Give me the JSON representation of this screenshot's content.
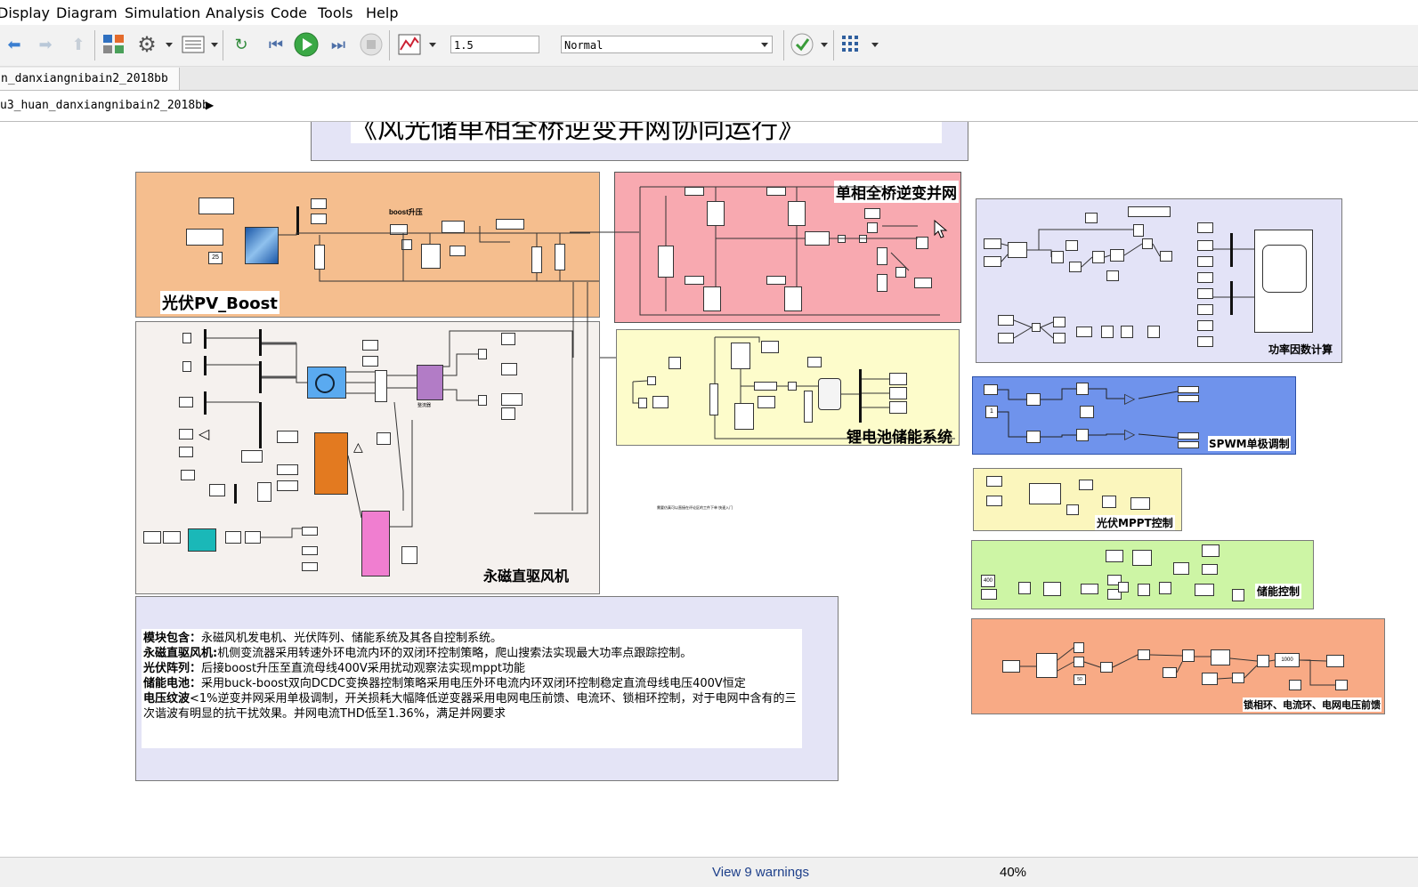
{
  "menu": [
    "Display",
    "Diagram",
    "Simulation",
    "Analysis",
    "Code",
    "Tools",
    "Help"
  ],
  "toolbar": {
    "stop_time": "1.5",
    "sim_mode": "Normal"
  },
  "tab": {
    "label": "n_danxiangnibain2_2018bb"
  },
  "breadcrumb": {
    "path": "u3_huan_danxiangnibain2_2018bb"
  },
  "canvas": {
    "title": "《风光储单相全桥逆变并网协同运行》",
    "areas": {
      "pv_boost": "光伏PV_Boost",
      "boost_label": "boost升压",
      "inverter": "单相全桥逆变并网",
      "pmsg": "永磁直驱风机",
      "battery": "锂电池储能系统",
      "power_factor": "功率因数计算",
      "spwm": "SPWM单极调制",
      "mppt": "光伏MPPT控制",
      "storage_ctrl": "储能控制",
      "pll": "锁相环、电流环、电网电压前馈",
      "irradiance_const": "25",
      "rectifier_label": "整流器",
      "const_1": "1",
      "const_400": "400",
      "const_50": "50",
      "const_1000": "1000",
      "tiny_note": "需要仿真可以直接在评论区的工件下单 快速入门"
    },
    "description": [
      {
        "bold": "模块包含：",
        "text": "永磁风机发电机、光伏阵列、储能系统及其各自控制系统。"
      },
      {
        "bold": "永磁直驱风机:",
        "text": "机侧变流器采用转速外环电流内环的双闭环控制策略，爬山搜索法实现最大功率点跟踪控制。"
      },
      {
        "bold": "光伏阵列：",
        "text": "后接boost升压至直流母线400V采用扰动观察法实现mppt功能"
      },
      {
        "bold": "储能电池：",
        "text": "采用buck-boost双向DCDC变换器控制策略采用电压外环电流内环双闭环控制稳定直流母线电压400V恒定"
      },
      {
        "bold": "电压纹波",
        "text": "<1%逆变并网采用单极调制，开关损耗大幅降低逆变器采用电网电压前馈、电流环、锁相环控制，对于电网中含有的三次谐波有明显的抗干扰效果。并网电流THD低至1.36%，满足并网要求"
      }
    ]
  },
  "status": {
    "warnings": "View 9 warnings",
    "zoom": "40%"
  },
  "colors": {
    "pv_area": "#f5be8e",
    "inverter_area": "#f8a9b0",
    "pmsg_area": "#f5f1ee",
    "battery_area": "#fdfccb",
    "pf_area": "#e3e3f7",
    "spwm_area": "#6f93ec",
    "mppt_area": "#fbf6bd",
    "storage_area": "#cdf5a5",
    "pll_area": "#f8aa85",
    "desc_area": "#e4e4f6"
  }
}
